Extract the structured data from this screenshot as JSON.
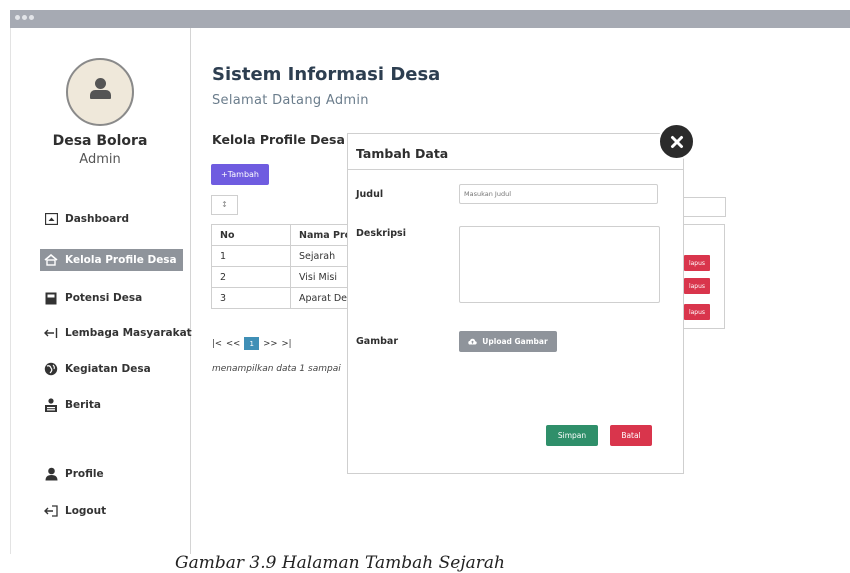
{
  "app": {
    "title": "Sistem Informasi Desa",
    "welcome": "Selamat Datang  Admin"
  },
  "sidebar": {
    "org_name": "Desa Bolora",
    "role": "Admin",
    "items": [
      {
        "label": "Dashboard",
        "icon": "dashboard-icon"
      },
      {
        "label": "Kelola Profile Desa",
        "icon": "home-icon",
        "active": true
      },
      {
        "label": "Potensi Desa",
        "icon": "book-icon"
      },
      {
        "label": "Lembaga Masyarakat",
        "icon": "arrow-left-icon"
      },
      {
        "label": "Kegiatan Desa",
        "icon": "globe-icon"
      },
      {
        "label": "Berita",
        "icon": "reader-icon"
      },
      {
        "label": "Profile",
        "icon": "user-icon"
      },
      {
        "label": "Logout",
        "icon": "logout-icon"
      }
    ]
  },
  "main": {
    "section_title": "Kelola Profile Desa",
    "add_button": "+Tambah",
    "filter_value": "↕",
    "table": {
      "headers": [
        "No",
        "Nama Pro"
      ],
      "rows": [
        {
          "no": "1",
          "nama": "Sejarah",
          "action": "lapus"
        },
        {
          "no": "2",
          "nama": "Visi Misi",
          "action": "lapus"
        },
        {
          "no": "3",
          "nama": "Aparat De",
          "action": "lapus"
        }
      ]
    },
    "pager": {
      "first": "|<",
      "prev": "<<",
      "page": "1",
      "next": ">>",
      "last": ">|"
    },
    "info_text": "menampilkan data 1 sampai"
  },
  "modal": {
    "title": "Tambah Data",
    "fields": {
      "judul_label": "Judul",
      "judul_placeholder": "Masukan Judul",
      "deskripsi_label": "Deskripsi",
      "gambar_label": "Gambar"
    },
    "upload_button": "Upload Gambar",
    "save_button": "Simpan",
    "cancel_button": "Batal"
  },
  "caption": "Gambar 3.9 Halaman Tambah Sejarah",
  "colors": {
    "accent_purple": "#6f5ce0",
    "danger": "#d9354c",
    "success": "#2f8f6a",
    "neutral": "#8f949b"
  }
}
